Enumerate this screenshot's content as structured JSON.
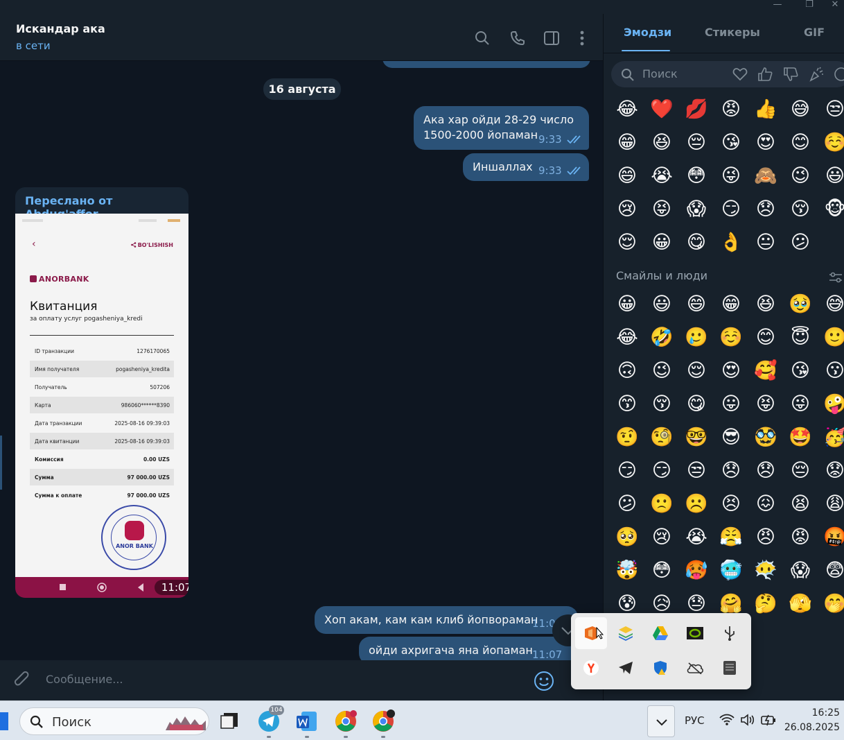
{
  "window": {
    "minimize": "—",
    "maximize": "❐",
    "close": "✕"
  },
  "header": {
    "name": "Искандар ака",
    "status": "в сети"
  },
  "chat": {
    "date": "16 августа",
    "messages": [
      {
        "text": "Ака хар ойди 28-29 число\n1500-2000 йопаман",
        "time": "9:33"
      },
      {
        "text": "Иншаллах",
        "time": "9:33"
      },
      {
        "text": "Хоп акам, кам кам клиб йопвораман",
        "time": "11:0"
      },
      {
        "text": "ойди ахригача яна йопаман",
        "time": "11:07"
      }
    ],
    "forwarded": {
      "title": "Переслано от Abdug'affor",
      "time": "11:07",
      "receipt": {
        "back": "‹",
        "share": "BO'LISHISH",
        "bank": "ANORBANK",
        "title": "Квитанция",
        "subtitle": "за оплату услуг  pogasheniya_kredi",
        "rows": [
          {
            "k": "ID транзакции",
            "v": "1276170065"
          },
          {
            "k": "Имя получателя",
            "v": "pogasheniya_kredita"
          },
          {
            "k": "Получатель",
            "v": "507206"
          },
          {
            "k": "Карта",
            "v": "986060******8390"
          },
          {
            "k": "Дата транзакции",
            "v": "2025-08-16 09:39:03"
          },
          {
            "k": "Дата квитанции",
            "v": "2025-08-16 09:39:03"
          },
          {
            "k": "Комиссия",
            "v": "0.00 UZS"
          },
          {
            "k": "Сумма",
            "v": "97 000.00 UZS"
          },
          {
            "k": "Сумма к оплате",
            "v": "97 000.00 UZS"
          }
        ],
        "stamp": "ANOR BANK"
      }
    }
  },
  "composer": {
    "placeholder": "Сообщение..."
  },
  "panel": {
    "tabs": [
      "Эмодзи",
      "Стикеры",
      "GIF"
    ],
    "search_placeholder": "Поиск",
    "section_title": "Смайлы и люди",
    "recent": [
      "😂",
      "❤️",
      "💋",
      "😡",
      "👍",
      "😅",
      "😒",
      "😁",
      "😆",
      "😔",
      "😘",
      "😍",
      "😊",
      "☺️",
      "😄",
      "😭",
      "😳",
      "😜",
      "🙈",
      "😉",
      "😃",
      "😢",
      "😝",
      "😱",
      "😏",
      "😞",
      "😚",
      "🐵",
      "😌",
      "😀",
      "😋",
      "👌",
      "😐",
      "😕"
    ],
    "people": [
      "😀",
      "😃",
      "😄",
      "😁",
      "😆",
      "🥹",
      "😅",
      "😂",
      "🤣",
      "🥲",
      "☺️",
      "😊",
      "😇",
      "🙂",
      "🙃",
      "😉",
      "😌",
      "😍",
      "🥰",
      "😘",
      "😗",
      "😙",
      "😚",
      "😋",
      "😛",
      "😝",
      "😜",
      "🤪",
      "🤨",
      "🧐",
      "🤓",
      "😎",
      "🥸",
      "🤩",
      "🥳",
      "😏",
      "😏",
      "😒",
      "😞",
      "😞",
      "😔",
      "😟",
      "😕",
      "🙁",
      "☹️",
      "😣",
      "😖",
      "😫",
      "😩",
      "🥺",
      "😢",
      "😭",
      "😤",
      "😠",
      "😡",
      "🤬",
      "🤯",
      "😳",
      "🥵",
      "🥶",
      "😶‍🌫️",
      "😱",
      "😨",
      "😰",
      "😥",
      "😓",
      "🤗",
      "🤔",
      "🫣",
      "🤭",
      "🫢",
      "🫡",
      "🤫",
      "🫠"
    ]
  },
  "tray": {
    "icons": [
      "office-icon",
      "layers-icon",
      "google-drive-icon",
      "nvidia-icon",
      "usb-icon",
      "yandex-icon",
      "telegram-icon",
      "defender-icon",
      "onedrive-icon",
      "keyboard-icon"
    ]
  },
  "taskbar": {
    "search_placeholder": "Поиск",
    "telegram_badge": "104",
    "language": "РУС",
    "time": "16:25",
    "date": "26.08.2025"
  },
  "colors": {
    "accent": "#6ab3f3",
    "bubble": "#2b5278",
    "background": "#0e1621",
    "sidebar": "#17212b",
    "bank": "#8b1b4a"
  }
}
